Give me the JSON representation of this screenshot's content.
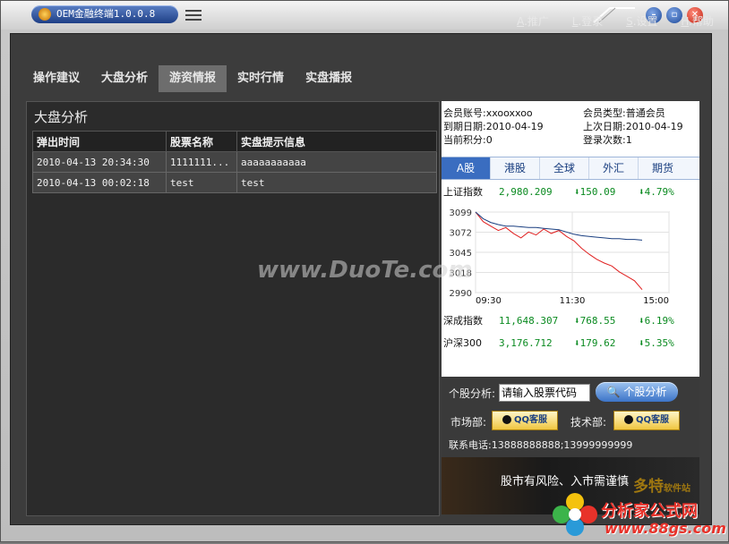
{
  "window": {
    "title": "OEM金融终端1.0.0.8"
  },
  "topnav": [
    {
      "key": "A",
      "label": ".推广"
    },
    {
      "key": "L",
      "label": ".登录"
    },
    {
      "key": "S",
      "label": ".设置"
    },
    {
      "key": "H",
      "label": ".帮助"
    }
  ],
  "tabs": [
    "操作建议",
    "大盘分析",
    "游资情报",
    "实时行情",
    "实盘播报"
  ],
  "panel": {
    "title": "大盘分析",
    "columns": [
      "弹出时间",
      "股票名称",
      "实盘提示信息"
    ],
    "rows": [
      [
        "2010-04-13 20:34:30",
        "1111111...",
        "aaaaaaaaaaa"
      ],
      [
        "2010-04-13 00:02:18",
        "test",
        "test"
      ]
    ]
  },
  "account": {
    "member_no": "会员账号:xxooxxoo",
    "member_type": "会员类型:普通会员",
    "expire": "到期日期:2010-04-19",
    "last_date": "上次日期:2010-04-19",
    "points": "当前积分:0",
    "login_count": "登录次数:1"
  },
  "market_tabs": [
    "A股",
    "港股",
    "全球",
    "外汇",
    "期货"
  ],
  "indices": [
    {
      "name": "上证指数",
      "value": "2,980.209",
      "change": "150.09",
      "pct": "4.79%"
    },
    {
      "name": "深成指数",
      "value": "11,648.307",
      "change": "768.55",
      "pct": "6.19%"
    },
    {
      "name": "沪深300",
      "value": "3,176.712",
      "change": "179.62",
      "pct": "5.35%"
    }
  ],
  "chart_data": {
    "type": "line",
    "yticks": [
      "3099",
      "3072",
      "3045",
      "3018",
      "2990"
    ],
    "xticks": [
      "09:30",
      "11:30",
      "15:00"
    ],
    "ylim": [
      2990,
      3099
    ],
    "series": [
      {
        "color": "#e02020",
        "values": [
          3099,
          3086,
          3080,
          3074,
          3078,
          3070,
          3064,
          3072,
          3068,
          3076,
          3070,
          3074,
          3066,
          3060,
          3050,
          3042,
          3035,
          3030,
          3026,
          3018,
          3012,
          3006,
          2994
        ]
      },
      {
        "color": "#1a3f80",
        "values": [
          3099,
          3090,
          3085,
          3082,
          3080,
          3080,
          3079,
          3078,
          3078,
          3077,
          3076,
          3075,
          3072,
          3069,
          3067,
          3066,
          3065,
          3064,
          3063,
          3063,
          3062,
          3062,
          3061
        ]
      }
    ]
  },
  "bottom": {
    "stock_label": "个股分析:",
    "stock_placeholder": "请输入股票代码",
    "analyze_button": "个股分析",
    "market_label": "市场部:",
    "tech_label": "技术部:",
    "qq_label": "QQ客服",
    "phone": "联系电话:13888888888;13999999999",
    "banner": "股市有风险、入市需谨慎"
  },
  "watermark": "www.DuoTe.com",
  "site_logo": {
    "line1": "分析家公式网",
    "line2": "www.88gs.com"
  },
  "duote_logo": {
    "main": "多特",
    "small": "软件站"
  }
}
